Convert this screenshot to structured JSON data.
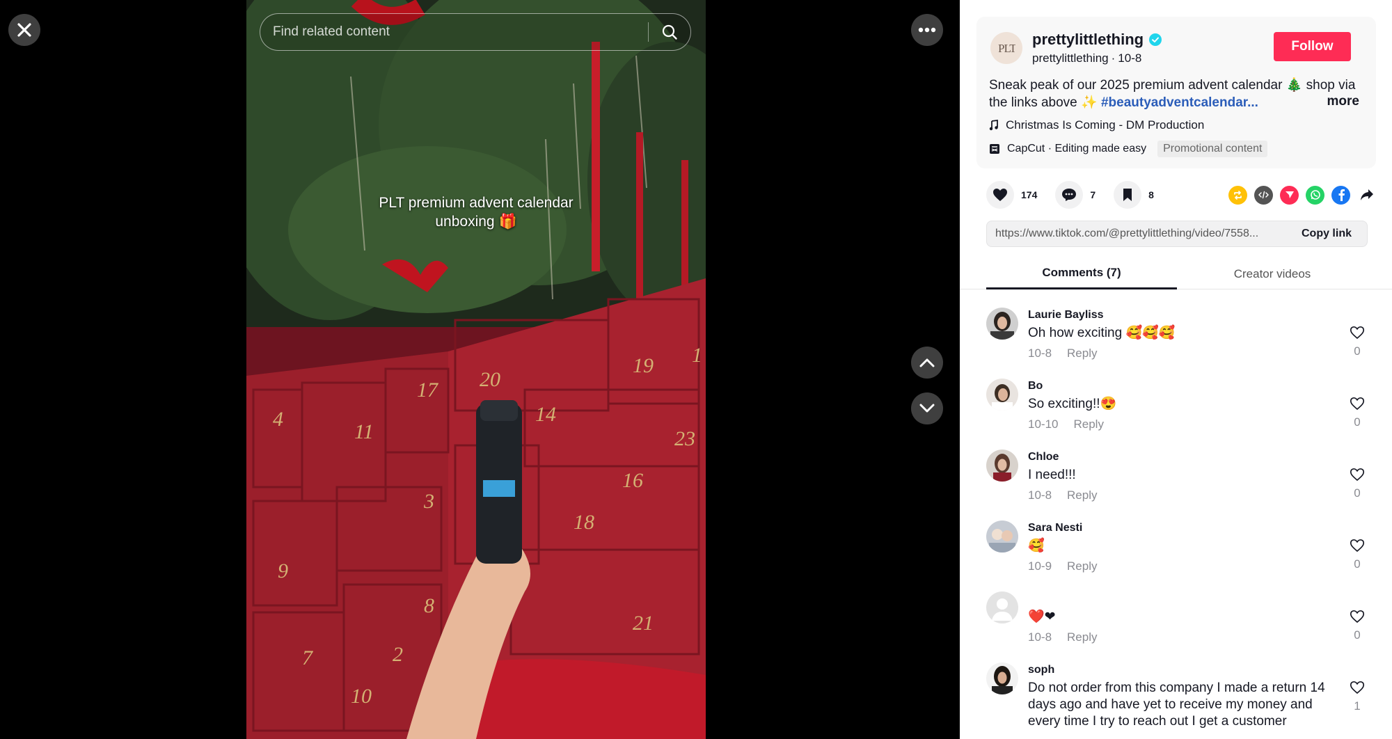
{
  "search": {
    "placeholder": "Find related content"
  },
  "video": {
    "caption": "PLT premium advent calendar unboxing 🎁"
  },
  "post": {
    "username": "prettylittlething",
    "handle": "prettylittlething",
    "date": "10-8",
    "follow_label": "Follow",
    "description": "Sneak peak of our 2025 premium advent calendar 🎄 shop via the links above ✨ ",
    "hashtag": "#beautyadventcalendar...",
    "more_label": "more",
    "music": "Christmas Is Coming - DM Production",
    "capcut": "CapCut · Editing made easy",
    "promo_tag": "Promotional content"
  },
  "actions": {
    "likes": "174",
    "comments": "7",
    "saves": "8"
  },
  "share": {
    "url": "https://www.tiktok.com/@prettylittlething/video/7558...",
    "copy_label": "Copy link"
  },
  "tabs": {
    "comments": "Comments (7)",
    "creator": "Creator videos"
  },
  "comment_reply_label": "Reply",
  "comments": [
    {
      "name": "Laurie Bayliss",
      "text": "Oh how exciting 🥰🥰🥰",
      "date": "10-8",
      "likes": "0"
    },
    {
      "name": "Bo",
      "text": "So exciting!!😍",
      "date": "10-10",
      "likes": "0"
    },
    {
      "name": "Chloe",
      "text": "I need!!!",
      "date": "10-8",
      "likes": "0"
    },
    {
      "name": "Sara Nesti",
      "text": "🥰",
      "date": "10-9",
      "likes": "0"
    },
    {
      "name": "",
      "text": "❤️❤",
      "date": "10-8",
      "likes": "0"
    },
    {
      "name": "soph",
      "text": "Do not order from this company I made a return 14 days ago and have yet to receive my money and every time I try to reach out I get a customer",
      "date": "",
      "likes": "1"
    }
  ],
  "colors": {
    "follow": "#fe2c55",
    "hashtag": "#2b5db9",
    "verified": "#20d5ec"
  }
}
